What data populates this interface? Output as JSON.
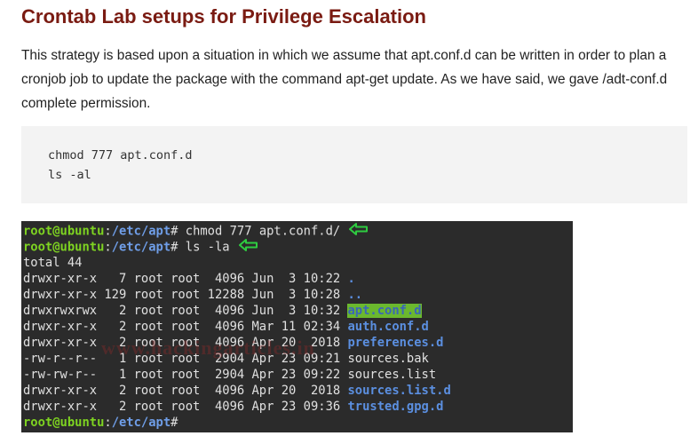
{
  "heading": "Crontab Lab setups for Privilege Escalation",
  "paragraph": "This strategy is based upon a situation in which we assume that apt.conf.d can be written in order to plan a cronjob job to update the package with the command apt-get update. As we have said, we gave /adt-conf.d complete permission.",
  "code_block": [
    "chmod 777 apt.conf.d",
    "ls -al"
  ],
  "terminal": {
    "prompt_user": "root@ubuntu",
    "prompt_path": "/etc/apt",
    "prompt_symbol": "#",
    "cmd1": " chmod 777 apt.conf.d/",
    "cmd2": " ls -la",
    "total": "total 44",
    "rows": [
      {
        "meta": "drwxr-xr-x   7 root root  4096 Jun  3 10:22 ",
        "name": ".",
        "style": "dir"
      },
      {
        "meta": "drwxr-xr-x 129 root root 12288 Jun  3 10:28 ",
        "name": "..",
        "style": "dir"
      },
      {
        "meta": "drwxrwxrwx   2 root root  4096 Jun  3 10:32 ",
        "name": "apt.conf.d",
        "style": "hl"
      },
      {
        "meta": "drwxr-xr-x   2 root root  4096 Mar 11 02:34 ",
        "name": "auth.conf.d",
        "style": "dir"
      },
      {
        "meta": "drwxr-xr-x   2 root root  4096 Apr 20  2018 ",
        "name": "preferences.d",
        "style": "dir"
      },
      {
        "meta": "-rw-r--r--   1 root root  2904 Apr 23 09:21 ",
        "name": "sources.bak",
        "style": "file"
      },
      {
        "meta": "-rw-rw-r--   1 root root  2904 Apr 23 09:22 ",
        "name": "sources.list",
        "style": "file"
      },
      {
        "meta": "drwxr-xr-x   2 root root  4096 Apr 20  2018 ",
        "name": "sources.list.d",
        "style": "dir"
      },
      {
        "meta": "drwxr-xr-x   2 root root  4096 Apr 23 09:36 ",
        "name": "trusted.gpg.d",
        "style": "dir"
      }
    ],
    "watermark": "www.hackingarticles.in"
  },
  "colors": {
    "heading": "#7a1b12",
    "terminal_bg": "#2b2b2b",
    "prompt_green": "#7ed321",
    "dir_blue": "#5b8fe0",
    "highlight_bg": "#6bb82e",
    "arrow_green": "#2ecc40"
  },
  "icons": [
    "left-arrow-icon",
    "left-arrow-icon"
  ]
}
